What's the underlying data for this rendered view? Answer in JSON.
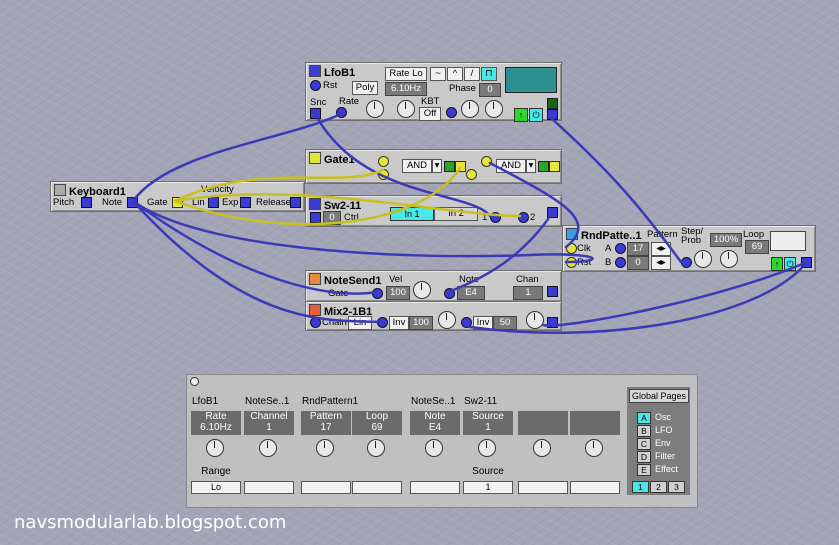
{
  "colors": {
    "port": "#3a3ad6",
    "gate_port": "#e6e63a",
    "cable": "#3a3ab6",
    "active": "#4be6e6"
  },
  "lfo": {
    "title": "LfoB1",
    "rst": "Rst",
    "poly": "Poly",
    "rate_mode": "Rate Lo",
    "rate_value": "6.10Hz",
    "phase_label": "Phase",
    "phase_value": "0",
    "snc": "Snc",
    "rate_label": "Rate",
    "kbt_label": "KBT",
    "kbt_value": "Off",
    "waveforms": [
      "sine-icon",
      "triangle-icon",
      "saw-icon",
      "square-icon"
    ]
  },
  "gate": {
    "title": "Gate1",
    "op1": "AND",
    "op2": "AND"
  },
  "keyboard": {
    "title": "Keyboard1",
    "pitch": "Pitch",
    "note": "Note",
    "gate": "Gate",
    "velocity": "Velocity",
    "lin": "Lin",
    "exp": "Exp",
    "release": "Release"
  },
  "sw": {
    "title": "Sw2-11",
    "ctrl_value": "0",
    "ctrl_label": "Ctrl",
    "in1": "In 1",
    "in2": "In 2",
    "port1": "1",
    "port2": "2"
  },
  "rnd": {
    "title": "RndPatte..1",
    "pattern": "Pattern",
    "step_prob": "Step/\nProb",
    "loop": "Loop",
    "clk": "Clk",
    "rst": "Rst",
    "a": "A",
    "b": "B",
    "a_value": "17",
    "b_value": "0",
    "prob_value": "100%",
    "loop_value": "69"
  },
  "notesend": {
    "title": "NoteSend1",
    "gate": "Gate",
    "vel": "Vel",
    "vel_value": "100",
    "note": "Note",
    "note_value": "E4",
    "chan": "Chan",
    "chan_value": "1"
  },
  "mix": {
    "title": "Mix2-1B1",
    "chain": "Chain",
    "lin": "Lin",
    "inv1": "Inv",
    "val1": "100",
    "inv2": "Inv",
    "val2": "50"
  },
  "panel": {
    "columns": [
      {
        "module": "LfoB1",
        "param": "Rate",
        "value": "6.10Hz",
        "sub": "Range",
        "sub_value": "Lo"
      },
      {
        "module": "NoteSe..1",
        "param": "Channel",
        "value": "1",
        "sub": "",
        "sub_value": ""
      },
      {
        "module": "RndPattern1",
        "param": "Pattern",
        "value": "17",
        "sub": "",
        "sub_value": ""
      },
      {
        "module": "",
        "param": "Loop",
        "value": "69",
        "sub": "",
        "sub_value": ""
      },
      {
        "module": "NoteSe..1",
        "param": "Note",
        "value": "E4",
        "sub": "",
        "sub_value": ""
      },
      {
        "module": "Sw2-11",
        "param": "Source",
        "value": "1",
        "sub": "Source",
        "sub_value": "1"
      },
      {
        "module": "",
        "param": "",
        "value": "",
        "sub": "",
        "sub_value": ""
      },
      {
        "module": "",
        "param": "",
        "value": "",
        "sub": "",
        "sub_value": ""
      }
    ],
    "global": {
      "title": "Global Pages",
      "pages": [
        {
          "key": "A",
          "label": "Osc"
        },
        {
          "key": "B",
          "label": "LFO"
        },
        {
          "key": "C",
          "label": "Env"
        },
        {
          "key": "D",
          "label": "Filter"
        },
        {
          "key": "E",
          "label": "Effect"
        }
      ],
      "numbers": [
        "1",
        "2",
        "3"
      ]
    }
  },
  "footer": {
    "url": "navsmodularlab.blogspot.com"
  }
}
